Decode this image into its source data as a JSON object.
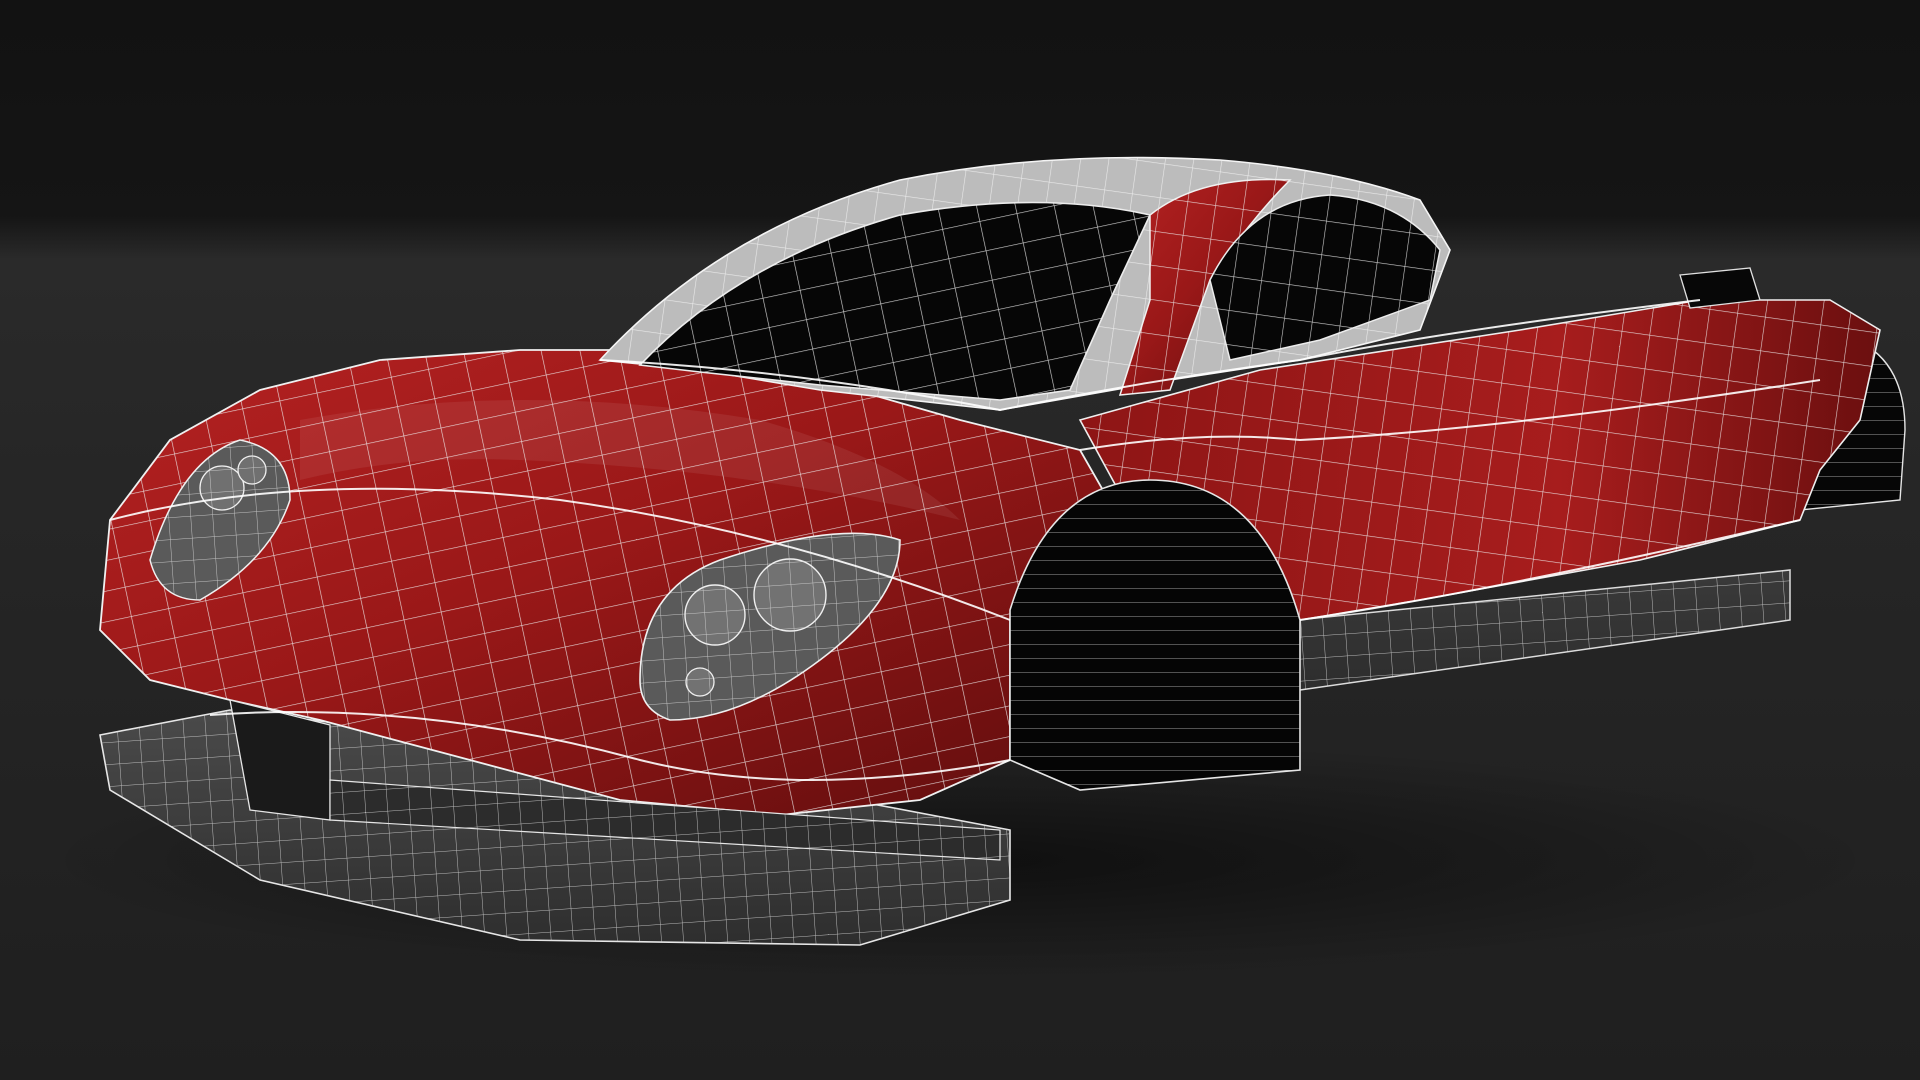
{
  "scene": {
    "subject": "wireframe-sports-car-render",
    "colors": {
      "background": "#1c1c1c",
      "floor": "#262626",
      "body_paint": "#9e1a1a",
      "body_highlight": "#c62b2b",
      "body_shadow": "#5a0c0c",
      "glass": "#050505",
      "wire": "#e8e8e8",
      "splitter": "#3c3c3c"
    }
  }
}
